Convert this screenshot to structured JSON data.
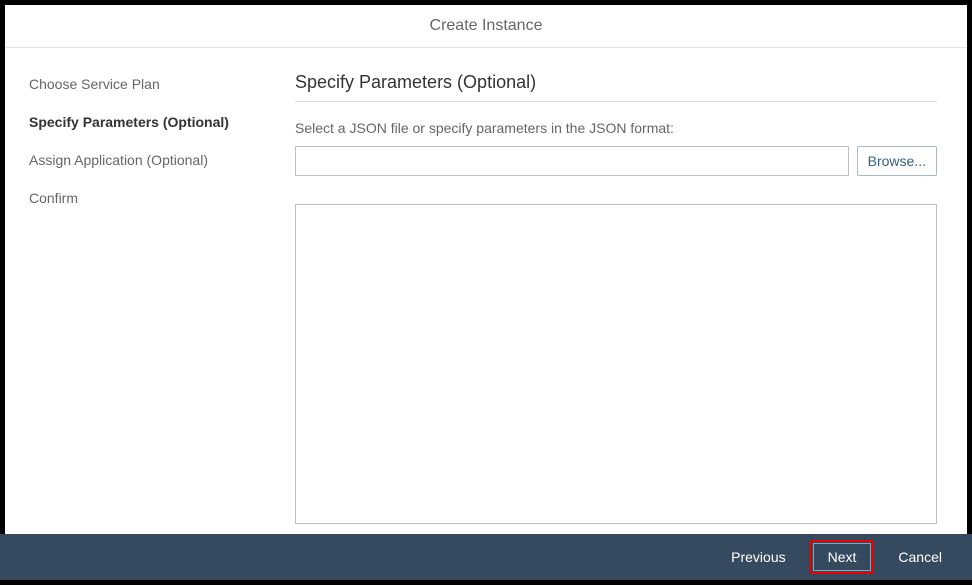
{
  "header": {
    "title": "Create Instance"
  },
  "sidebar": {
    "steps": [
      {
        "label": "Choose Service Plan",
        "active": false
      },
      {
        "label": "Specify Parameters (Optional)",
        "active": true
      },
      {
        "label": "Assign Application (Optional)",
        "active": false
      },
      {
        "label": "Confirm",
        "active": false
      }
    ]
  },
  "main": {
    "panel_title": "Specify Parameters (Optional)",
    "instruction": "Select a JSON file or specify parameters in the JSON format:",
    "file_value": "",
    "browse_label": "Browse...",
    "json_value": ""
  },
  "footer": {
    "previous": "Previous",
    "next": "Next",
    "cancel": "Cancel"
  }
}
